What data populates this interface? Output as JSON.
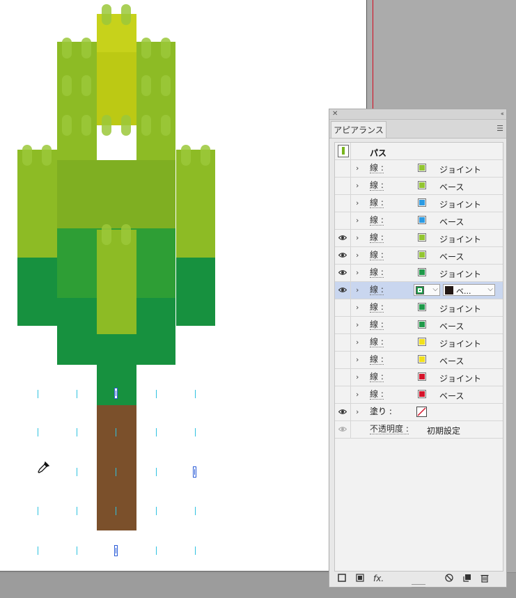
{
  "colors": {
    "lime": "#8dbb25",
    "yellow_green": "#bcc914",
    "mid_green": "#2e9e35",
    "dark_green": "#17913f",
    "brown": "#7b502b",
    "guide": "#2ec2e0",
    "selection": "#2a5bd7"
  },
  "panel": {
    "close_icon": "close-icon",
    "collapse_icon": "double-chevron-left-icon",
    "tab": "アピアランス",
    "menu_icon": "hamburger-menu-icon",
    "title": "パス",
    "rows": [
      {
        "label": "線 :",
        "name": "ジョイント",
        "color": "#93c531",
        "visible": false
      },
      {
        "label": "線 :",
        "name": "ベース",
        "color": "#93c531",
        "visible": false
      },
      {
        "label": "線 :",
        "name": "ジョイント",
        "color": "#2b9be3",
        "visible": false
      },
      {
        "label": "線 :",
        "name": "ベース",
        "color": "#2b9be3",
        "visible": false
      },
      {
        "label": "線 :",
        "name": "ジョイント",
        "color": "#93c531",
        "visible": true
      },
      {
        "label": "線 :",
        "name": "ベース",
        "color": "#93c531",
        "visible": true
      },
      {
        "label": "線 :",
        "name": "ジョイント",
        "color": "#1f9a4a",
        "visible": true
      },
      {
        "label": "線 :",
        "name": "ベ...",
        "color": "#1f9a4a",
        "visible": true,
        "selected": true,
        "dropdown_color": "#231815"
      },
      {
        "label": "線 :",
        "name": "ジョイント",
        "color": "#1f9a4a",
        "visible": false
      },
      {
        "label": "線 :",
        "name": "ベース",
        "color": "#1f9a4a",
        "visible": false
      },
      {
        "label": "線 :",
        "name": "ジョイント",
        "color": "#f2e11b",
        "visible": false
      },
      {
        "label": "線 :",
        "name": "ベース",
        "color": "#f2e11b",
        "visible": false
      },
      {
        "label": "線 :",
        "name": "ジョイント",
        "color": "#d6132a",
        "visible": false
      },
      {
        "label": "線 :",
        "name": "ベース",
        "color": "#d6132a",
        "visible": false
      }
    ],
    "fill_label": "塗り :",
    "opacity_label": "不透明度 :",
    "opacity_value": "初期設定",
    "toolbar": {
      "fx": "fx."
    }
  }
}
